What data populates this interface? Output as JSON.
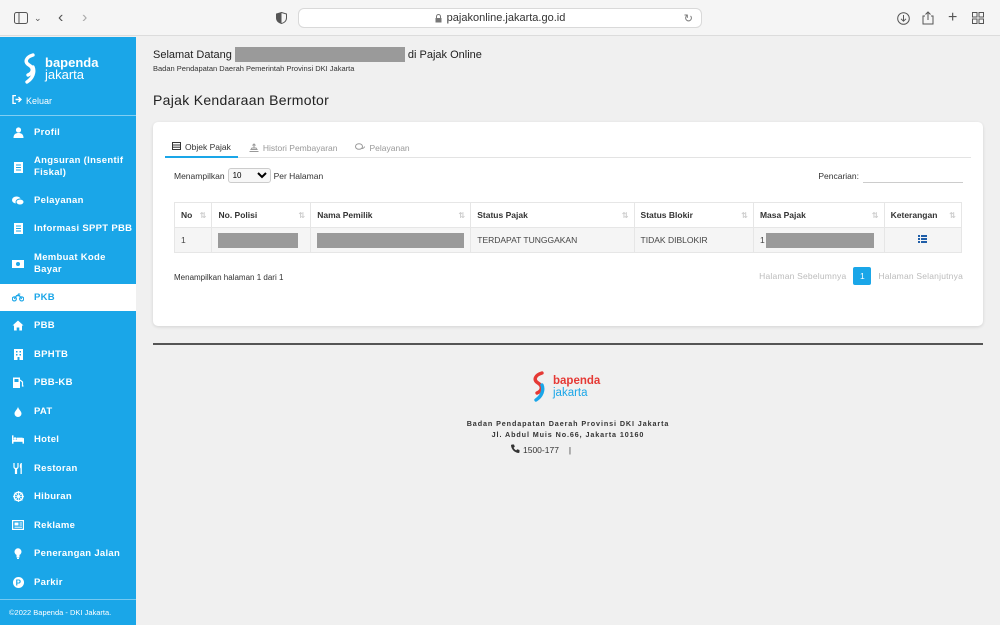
{
  "browser": {
    "url": "pajakonline.jakarta.go.id"
  },
  "sidebar": {
    "logo_line1": "bapenda",
    "logo_line2": "jakarta",
    "logout_label": "Keluar",
    "items": [
      {
        "label": "Profil",
        "icon": "user-icon"
      },
      {
        "label": "Angsuran (Insentif Fiskal)",
        "icon": "document-icon"
      },
      {
        "label": "Pelayanan",
        "icon": "chat-icon"
      },
      {
        "label": "Informasi SPPT PBB",
        "icon": "document-icon"
      },
      {
        "label": "Membuat Kode Bayar",
        "icon": "money-icon"
      },
      {
        "label": "PKB",
        "icon": "motorcycle-icon",
        "active": true
      },
      {
        "label": "PBB",
        "icon": "home-icon"
      },
      {
        "label": "BPHTB",
        "icon": "building-icon"
      },
      {
        "label": "PBB-KB",
        "icon": "gas-station-icon"
      },
      {
        "label": "PAT",
        "icon": "water-drop-icon"
      },
      {
        "label": "Hotel",
        "icon": "bed-icon"
      },
      {
        "label": "Restoran",
        "icon": "cutlery-icon"
      },
      {
        "label": "Hiburan",
        "icon": "dharma-wheel-icon"
      },
      {
        "label": "Reklame",
        "icon": "billboard-icon"
      },
      {
        "label": "Penerangan Jalan",
        "icon": "lightbulb-icon"
      },
      {
        "label": "Parkir",
        "icon": "parking-icon"
      }
    ],
    "footer": "©2022 Bapenda - DKI Jakarta."
  },
  "header": {
    "welcome_prefix": "Selamat Datang",
    "welcome_suffix": "di Pajak Online",
    "subtitle": "Badan Pendapatan Daerah Pemerintah Provinsi DKI Jakarta",
    "page_title": "Pajak Kendaraan Bermotor"
  },
  "tabs": [
    {
      "label": "Objek Pajak",
      "active": true
    },
    {
      "label": "Histori Pembayaran"
    },
    {
      "label": "Pelayanan"
    }
  ],
  "table_controls": {
    "show_prefix": "Menampilkan",
    "page_size": "10",
    "show_suffix": "Per Halaman",
    "search_label": "Pencarian:",
    "search_value": ""
  },
  "table": {
    "columns": [
      "No",
      "No. Polisi",
      "Nama Pemilik",
      "Status Pajak",
      "Status Blokir",
      "Masa Pajak",
      "Keterangan"
    ],
    "rows": [
      {
        "no": "1",
        "no_polisi": "",
        "nama_pemilik": "",
        "status_pajak": "TERDAPAT TUNGGAKAN",
        "status_blokir": "TIDAK DIBLOKIR",
        "masa_pajak": "1"
      }
    ]
  },
  "pagination": {
    "info": "Menampilkan halaman 1 dari 1",
    "prev": "Halaman Sebelumnya",
    "current": "1",
    "next": "Halaman Selanjutnya"
  },
  "footer": {
    "logo_line1": "bapenda",
    "logo_line2": "jakarta",
    "org": "Badan Pendapatan Daerah Provinsi DKI Jakarta",
    "address": "Jl. Abdul Muis No.66, Jakarta 10160",
    "phone": "1500-177",
    "separator": "|"
  },
  "colors": {
    "brand_blue": "#1aa6e8",
    "brand_red": "#e53935",
    "icon_list": "#1f5ea8"
  }
}
